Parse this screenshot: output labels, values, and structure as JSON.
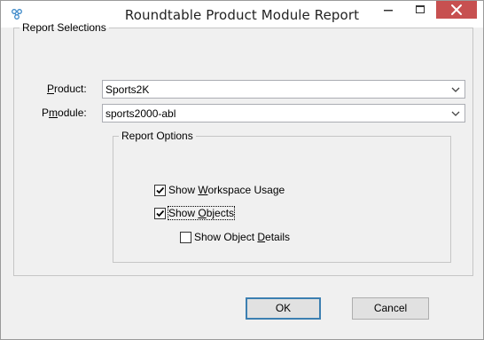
{
  "window": {
    "title": "Roundtable Product Module Report"
  },
  "report_selections": {
    "legend": "Report Selections",
    "product": {
      "label_prefix": "",
      "label_accel": "P",
      "label_suffix": "roduct:",
      "value": "Sports2K"
    },
    "pmodule": {
      "label_prefix": "P",
      "label_accel": "m",
      "label_suffix": "odule:",
      "value": "sports2000-abl"
    }
  },
  "report_options": {
    "legend": "Report Options",
    "items": [
      {
        "pre": "Show ",
        "accel": "W",
        "post": "orkspace Usage",
        "checked": true
      },
      {
        "pre": "Show ",
        "accel": "O",
        "post": "bjects",
        "checked": true
      },
      {
        "pre": "Show Object ",
        "accel": "D",
        "post": "etails",
        "checked": false
      }
    ]
  },
  "buttons": {
    "ok": "OK",
    "cancel": "Cancel"
  },
  "colors": {
    "close_button": "#c75050",
    "window_bg": "#f0f0f0",
    "default_button_border": "#3c7fb1"
  }
}
